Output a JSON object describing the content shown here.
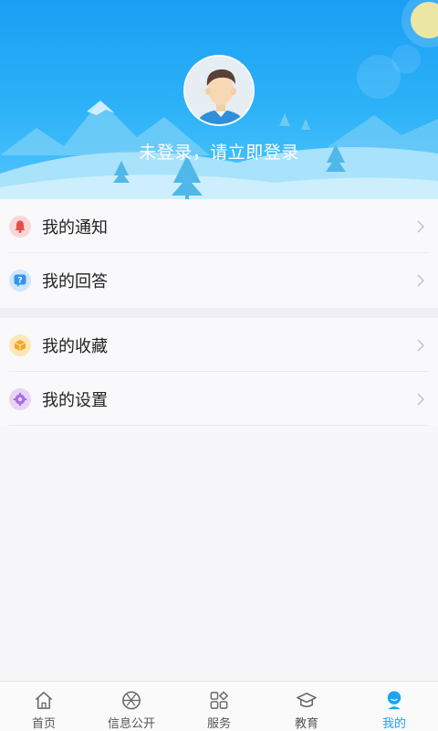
{
  "header": {
    "login_prompt": "未登录，请立即登录"
  },
  "menu": {
    "group1": [
      {
        "label": "我的通知",
        "icon": "bell-icon",
        "color": "#f06a6a"
      },
      {
        "label": "我的回答",
        "icon": "question-icon",
        "color": "#3fa2f2"
      }
    ],
    "group2": [
      {
        "label": "我的收藏",
        "icon": "box-icon",
        "color": "#f6b63c"
      },
      {
        "label": "我的设置",
        "icon": "gear-icon",
        "color": "#b57be3"
      }
    ]
  },
  "tabbar": {
    "tabs": [
      {
        "label": "首页",
        "icon": "home-icon"
      },
      {
        "label": "信息公开",
        "icon": "aperture-icon"
      },
      {
        "label": "服务",
        "icon": "grid-icon"
      },
      {
        "label": "教育",
        "icon": "graduation-cap-icon"
      },
      {
        "label": "我的",
        "icon": "user-icon",
        "active": true
      }
    ]
  },
  "colors": {
    "header_blue": "#1a9ff3",
    "accent": "#1ea3f0"
  }
}
